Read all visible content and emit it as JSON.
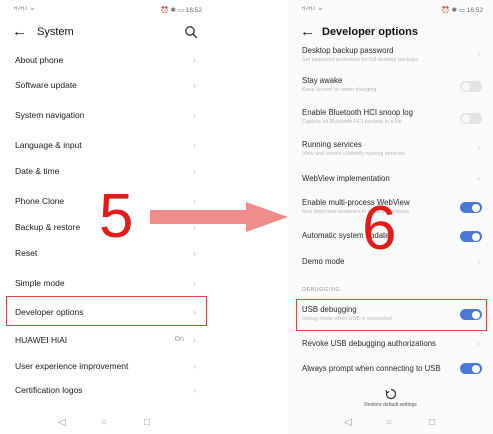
{
  "left": {
    "status_left": "ᴴᴶᴴᴶ ≈",
    "status_right": "⏰ ✱ ▭ 16:52",
    "title": "System",
    "items": [
      {
        "label": "About phone"
      },
      {
        "label": "Software update"
      },
      {
        "label": "System navigation"
      },
      {
        "label": "Language & input"
      },
      {
        "label": "Date & time"
      },
      {
        "label": "Phone Clone"
      },
      {
        "label": "Backup & restore"
      },
      {
        "label": "Reset"
      },
      {
        "label": "Simple mode"
      },
      {
        "label": "Developer options"
      },
      {
        "label": "HUAWEI HiAI",
        "value": "On"
      },
      {
        "label": "User experience improvement"
      },
      {
        "label": "Certification logos"
      }
    ]
  },
  "right": {
    "status_left": "ᴴᴶᴴᴶ ≈",
    "status_right": "⏰ ✱ ▭ 16:52",
    "title": "Developer options",
    "options": [
      {
        "title": "Desktop backup password",
        "subtitle": "Set password protection for full desktop backups"
      },
      {
        "title": "Stay awake",
        "subtitle": "Keep screen on when charging"
      },
      {
        "title": "Enable Bluetooth HCI snoop log",
        "subtitle": "Capture all Bluetooth HCI packets in a file"
      },
      {
        "title": "Running services",
        "subtitle": "View and control currently running services"
      },
      {
        "title": "WebView implementation"
      },
      {
        "title": "Enable multi-process WebView",
        "subtitle": "Run WebView renderers in separate process"
      },
      {
        "title": "Automatic system updates"
      },
      {
        "title": "Demo mode"
      },
      {
        "title": "USB debugging",
        "subtitle": "Debug mode when USB is connected"
      },
      {
        "title": "Revoke USB debugging authorizations"
      },
      {
        "title": "Always prompt when connecting to USB"
      }
    ],
    "section_debugging": "DEBUGGING",
    "restore_label": "Restore default settings"
  },
  "nav": {
    "back": "◁",
    "home": "○",
    "recents": "□"
  },
  "steps": {
    "first": "5",
    "second": "6"
  },
  "colors": {
    "accent": "#4a78d4",
    "highlight": "#e04545",
    "step": "#e21b1b",
    "arrow": "#f08c8c"
  },
  "icons": {
    "back": "back-arrow-icon",
    "search": "search-icon",
    "chevron": "chevron-right-icon",
    "restore": "restore-icon"
  }
}
